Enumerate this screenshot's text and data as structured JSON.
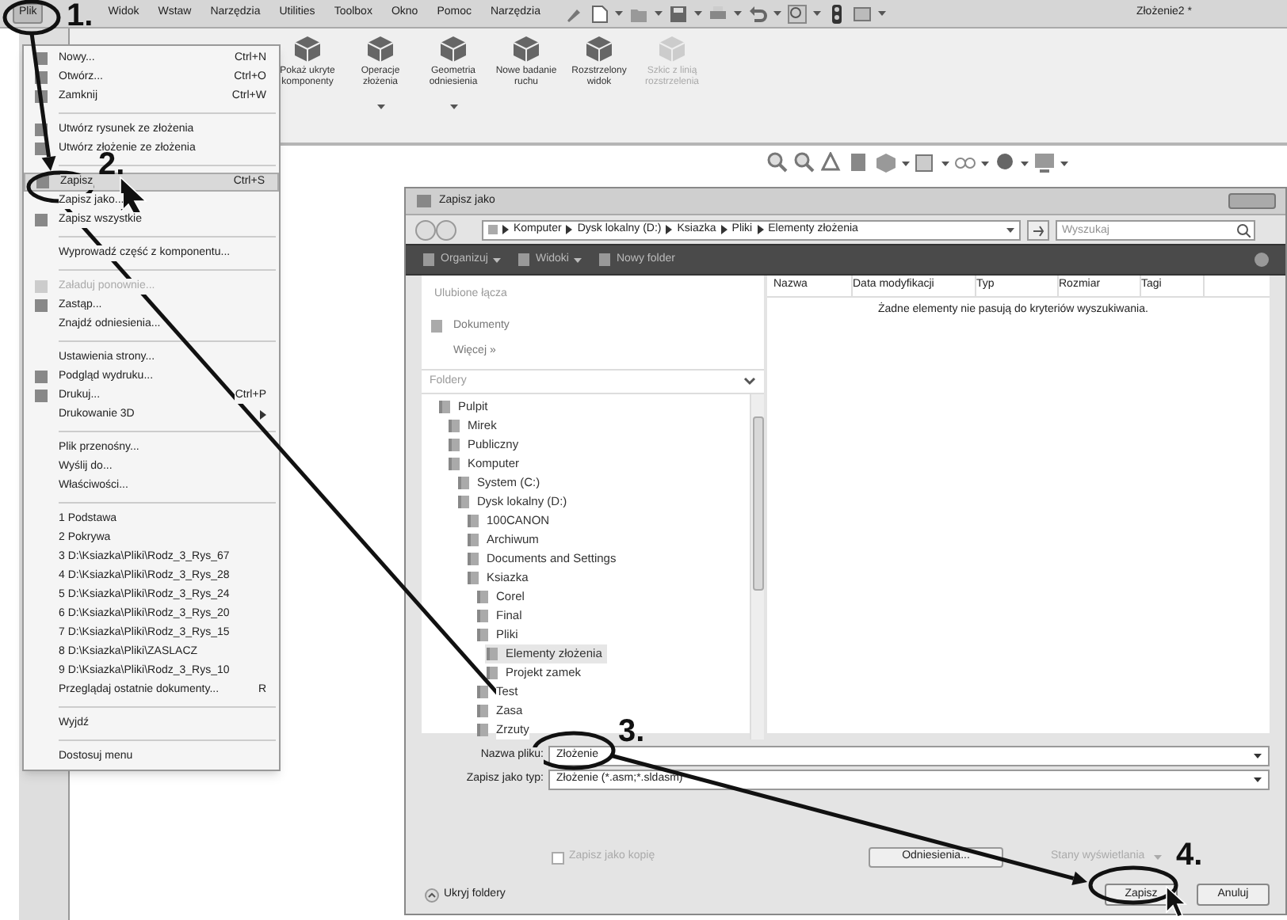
{
  "menu_bar": {
    "items": [
      {
        "label": "Plik",
        "selected": true
      },
      {
        "label": "Widok",
        "selected": false
      },
      {
        "label": "Wstaw",
        "selected": false
      },
      {
        "label": "Narzędzia",
        "selected": false
      },
      {
        "label": "Utilities",
        "selected": false
      },
      {
        "label": "Toolbox",
        "selected": false
      },
      {
        "label": "Okno",
        "selected": false
      },
      {
        "label": "Pomoc",
        "selected": false
      },
      {
        "label": "Narzędzia",
        "selected": false
      }
    ],
    "document_title": "Złożenie2 *"
  },
  "ribbon": {
    "buttons": [
      {
        "label": "Pokaż ukryte komponenty",
        "disabled": false,
        "dropdown": false
      },
      {
        "label": "Operacje złożenia",
        "disabled": false,
        "dropdown": true
      },
      {
        "label": "Geometria odniesienia",
        "disabled": false,
        "dropdown": true
      },
      {
        "label": "Nowe badanie ruchu",
        "disabled": false,
        "dropdown": false
      },
      {
        "label": "Rozstrzelony widok",
        "disabled": false,
        "dropdown": false
      },
      {
        "label": "Szkic z linią rozstrzelenia",
        "disabled": true,
        "dropdown": false
      }
    ]
  },
  "file_menu": {
    "items": [
      {
        "kind": "item",
        "label": "Nowy...",
        "shortcut": "Ctrl+N",
        "icon": true,
        "selected": false,
        "disabled": false
      },
      {
        "kind": "item",
        "label": "Otwórz...",
        "shortcut": "Ctrl+O",
        "icon": true,
        "selected": false,
        "disabled": false
      },
      {
        "kind": "item",
        "label": "Zamknij",
        "shortcut": "Ctrl+W",
        "icon": true,
        "selected": false,
        "disabled": false
      },
      {
        "kind": "separator"
      },
      {
        "kind": "item",
        "label": "Utwórz rysunek ze złożenia",
        "icon": true,
        "selected": false,
        "disabled": false
      },
      {
        "kind": "item",
        "label": "Utwórz złożenie ze złożenia",
        "icon": true,
        "selected": false,
        "disabled": false
      },
      {
        "kind": "separator"
      },
      {
        "kind": "item",
        "label": "Zapisz",
        "shortcut": "Ctrl+S",
        "icon": true,
        "selected": true,
        "disabled": false
      },
      {
        "kind": "item",
        "label": "Zapisz jako...",
        "icon": false,
        "selected": false,
        "disabled": false
      },
      {
        "kind": "item",
        "label": "Zapisz wszystkie",
        "icon": true,
        "selected": false,
        "disabled": false
      },
      {
        "kind": "separator"
      },
      {
        "kind": "item",
        "label": "Wyprowadź część z komponentu...",
        "icon": false,
        "selected": false,
        "disabled": false
      },
      {
        "kind": "separator"
      },
      {
        "kind": "item",
        "label": "Załaduj ponownie...",
        "icon": true,
        "selected": false,
        "disabled": true
      },
      {
        "kind": "item",
        "label": "Zastąp...",
        "icon": true,
        "selected": false,
        "disabled": false
      },
      {
        "kind": "item",
        "label": "Znajdź odniesienia...",
        "icon": false,
        "selected": false,
        "disabled": false
      },
      {
        "kind": "separator"
      },
      {
        "kind": "item",
        "label": "Ustawienia strony...",
        "icon": false,
        "selected": false,
        "disabled": false
      },
      {
        "kind": "item",
        "label": "Podgląd wydruku...",
        "icon": true,
        "selected": false,
        "disabled": false
      },
      {
        "kind": "item",
        "label": "Drukuj...",
        "shortcut": "Ctrl+P",
        "icon": true,
        "selected": false,
        "disabled": false
      },
      {
        "kind": "item",
        "label": "Drukowanie 3D",
        "icon": false,
        "submenu": true,
        "selected": false,
        "disabled": false
      },
      {
        "kind": "separator"
      },
      {
        "kind": "item",
        "label": "Plik przenośny...",
        "icon": false,
        "selected": false,
        "disabled": false
      },
      {
        "kind": "item",
        "label": "Wyślij do...",
        "icon": false,
        "selected": false,
        "disabled": false
      },
      {
        "kind": "item",
        "label": "Właściwości...",
        "icon": false,
        "selected": false,
        "disabled": false
      },
      {
        "kind": "separator"
      },
      {
        "kind": "item",
        "label": "1 Podstawa",
        "icon": false,
        "selected": false,
        "disabled": false
      },
      {
        "kind": "item",
        "label": "2 Pokrywa",
        "icon": false,
        "selected": false,
        "disabled": false
      },
      {
        "kind": "item",
        "label": "3 D:\\Ksiazka\\Pliki\\Rodz_3_Rys_67",
        "icon": false,
        "selected": false,
        "disabled": false
      },
      {
        "kind": "item",
        "label": "4 D:\\Ksiazka\\Pliki\\Rodz_3_Rys_28",
        "icon": false,
        "selected": false,
        "disabled": false
      },
      {
        "kind": "item",
        "label": "5 D:\\Ksiazka\\Pliki\\Rodz_3_Rys_24",
        "icon": false,
        "selected": false,
        "disabled": false
      },
      {
        "kind": "item",
        "label": "6 D:\\Ksiazka\\Pliki\\Rodz_3_Rys_20",
        "icon": false,
        "selected": false,
        "disabled": false
      },
      {
        "kind": "item",
        "label": "7 D:\\Ksiazka\\Pliki\\Rodz_3_Rys_15",
        "icon": false,
        "selected": false,
        "disabled": false
      },
      {
        "kind": "item",
        "label": "8 D:\\Ksiazka\\Pliki\\ZASLACZ",
        "icon": false,
        "selected": false,
        "disabled": false
      },
      {
        "kind": "item",
        "label": "9 D:\\Ksiazka\\Pliki\\Rodz_3_Rys_10",
        "icon": false,
        "selected": false,
        "disabled": false
      },
      {
        "kind": "item",
        "label": "Przeglądaj ostatnie dokumenty...",
        "shortcut": "R",
        "icon": false,
        "selected": false,
        "disabled": false
      },
      {
        "kind": "separator"
      },
      {
        "kind": "item",
        "label": "Wyjdź",
        "icon": false,
        "selected": false,
        "disabled": false
      },
      {
        "kind": "separator"
      },
      {
        "kind": "item",
        "label": "Dostosuj menu",
        "icon": false,
        "selected": false,
        "disabled": false
      }
    ]
  },
  "dialog": {
    "title": "Zapisz jako",
    "breadcrumb": [
      "Komputer",
      "Dysk lokalny (D:)",
      "Ksiazka",
      "Pliki",
      "Elementy złożenia"
    ],
    "search": {
      "placeholder": "Wyszukaj"
    },
    "toolbar": [
      {
        "label": "Organizuj",
        "dropdown": true
      },
      {
        "label": "Widoki",
        "dropdown": true
      },
      {
        "label": "Nowy folder",
        "dropdown": false
      }
    ],
    "favorites_header": "Ulubione łącza",
    "favorites": [
      "Dokumenty"
    ],
    "more_link": "Więcej »",
    "folders_header": "Foldery",
    "folders": [
      {
        "label": "Pulpit",
        "selected": false,
        "children": [
          {
            "label": "Mirek",
            "selected": false
          },
          {
            "label": "Publiczny",
            "selected": false
          },
          {
            "label": "Komputer",
            "selected": false,
            "children": [
              {
                "label": "System (C:)",
                "selected": false
              },
              {
                "label": "Dysk lokalny (D:)",
                "selected": false,
                "children": [
                  {
                    "label": "100CANON",
                    "selected": false
                  },
                  {
                    "label": "Archiwum",
                    "selected": false
                  },
                  {
                    "label": "Documents and Settings",
                    "selected": false
                  },
                  {
                    "label": "Ksiazka",
                    "selected": false,
                    "children": [
                      {
                        "label": "Corel",
                        "selected": false
                      },
                      {
                        "label": "Final",
                        "selected": false
                      },
                      {
                        "label": "Pliki",
                        "selected": false,
                        "children": [
                          {
                            "label": "Elementy złożenia",
                            "selected": true
                          },
                          {
                            "label": "Projekt zamek",
                            "selected": false
                          }
                        ]
                      },
                      {
                        "label": "Test",
                        "selected": false
                      },
                      {
                        "label": "Zasa",
                        "selected": false
                      },
                      {
                        "label": "Zrzuty",
                        "selected": false
                      }
                    ]
                  }
                ]
              }
            ]
          }
        ]
      }
    ],
    "columns": [
      "Nazwa",
      "Data modyfikacji",
      "Typ",
      "Rozmiar",
      "Tagi"
    ],
    "empty_message": "Żadne elementy nie pasują do kryteriów wyszukiwania.",
    "file_name": {
      "label": "Nazwa pliku:",
      "value": "Złożenie"
    },
    "file_type": {
      "label": "Zapisz jako typ:",
      "value": "Złożenie (*.asm;*.sldasm)"
    },
    "save_as_copy": {
      "label": "Zapisz jako kopię",
      "checked": false,
      "disabled": true
    },
    "references_button": "Odniesienia...",
    "display_states": {
      "label": "Stany wyświetlania",
      "disabled": true
    },
    "hide_folders": "Ukryj foldery",
    "save_button": "Zapisz",
    "cancel_button": "Anuluj"
  },
  "annotations": {
    "steps": [
      "1.",
      "2.",
      "3.",
      "4."
    ]
  }
}
